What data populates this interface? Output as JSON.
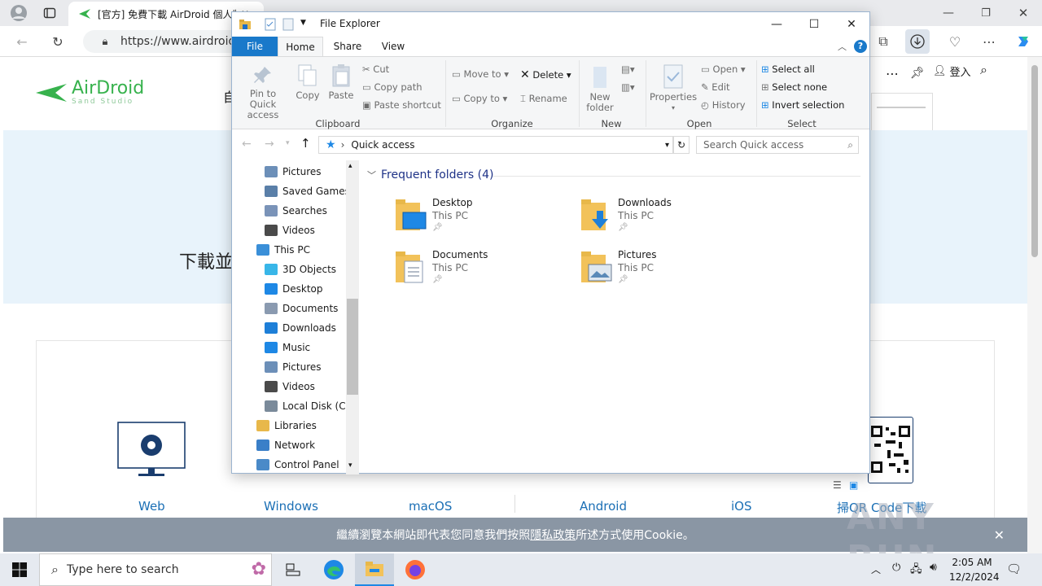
{
  "browser": {
    "tab_title": "[官方] 免費下載 AirDroid 個人版",
    "url": "https://www.airdroid.c",
    "login_label": "登入"
  },
  "webpage": {
    "logo_name": "AirDroid",
    "logo_sub": "Sand Studio",
    "hero_partial": "下載並",
    "side_partial": "自",
    "platforms": [
      "Web",
      "Windows",
      "macOS",
      "Android",
      "iOS",
      "掃QR Code下載"
    ],
    "cookie_prefix": "繼續瀏覽本網站即代表您同意我們按照",
    "cookie_link": "隱私政策",
    "cookie_suffix": "所述方式使用Cookie。"
  },
  "explorer": {
    "title": "File Explorer",
    "tabs": [
      "File",
      "Home",
      "Share",
      "View"
    ],
    "clipboard": {
      "pin_label": "Pin to Quick access",
      "copy_label": "Copy",
      "paste_label": "Paste",
      "cut_label": "Cut",
      "copy_path_label": "Copy path",
      "paste_shortcut_label": "Paste shortcut",
      "group_label": "Clipboard"
    },
    "organize": {
      "move_to_label": "Move to",
      "copy_to_label": "Copy to",
      "delete_label": "Delete",
      "rename_label": "Rename",
      "group_label": "Organize"
    },
    "new": {
      "new_folder_label": "New folder",
      "group_label": "New"
    },
    "open": {
      "properties_label": "Properties",
      "open_label": "Open",
      "edit_label": "Edit",
      "history_label": "History",
      "group_label": "Open"
    },
    "select": {
      "select_all_label": "Select all",
      "select_none_label": "Select none",
      "invert_label": "Invert selection",
      "group_label": "Select"
    },
    "address": "Quick access",
    "search_placeholder": "Search Quick access",
    "nav_items": [
      {
        "label": "Pictures",
        "color": "#6c8fb8"
      },
      {
        "label": "Saved Games",
        "color": "#5a7fa8"
      },
      {
        "label": "Searches",
        "color": "#7a93b8"
      },
      {
        "label": "Videos",
        "color": "#4a4a4a"
      },
      {
        "label": "This PC",
        "color": "#3a8fd8"
      },
      {
        "label": "3D Objects",
        "color": "#38b6e8"
      },
      {
        "label": "Desktop",
        "color": "#1e88e5"
      },
      {
        "label": "Documents",
        "color": "#8a9ab0"
      },
      {
        "label": "Downloads",
        "color": "#1e7fd8"
      },
      {
        "label": "Music",
        "color": "#1e88e5"
      },
      {
        "label": "Pictures",
        "color": "#6c8fb8"
      },
      {
        "label": "Videos",
        "color": "#4a4a4a"
      },
      {
        "label": "Local Disk (C:)",
        "color": "#7a8a9a"
      },
      {
        "label": "Libraries",
        "color": "#e8b84a"
      },
      {
        "label": "Network",
        "color": "#3a7fc8"
      },
      {
        "label": "Control Panel",
        "color": "#4a8ac8"
      }
    ],
    "frequent_header": "Frequent folders (4)",
    "folders": [
      {
        "name": "Desktop",
        "location": "This PC"
      },
      {
        "name": "Downloads",
        "location": "This PC"
      },
      {
        "name": "Documents",
        "location": "This PC"
      },
      {
        "name": "Pictures",
        "location": "This PC"
      }
    ]
  },
  "taskbar": {
    "search_placeholder": "Type here to search",
    "time": "2:05 AM",
    "date": "12/2/2024"
  },
  "watermark": "ANY RUN"
}
